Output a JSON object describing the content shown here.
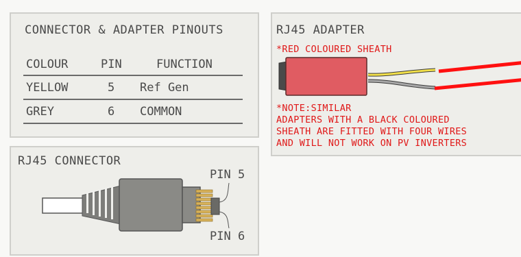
{
  "pinouts": {
    "title": "CONNECTOR & ADAPTER PINOUTS",
    "headers": [
      "COLOUR",
      "PIN",
      "FUNCTION"
    ],
    "rows": [
      [
        "YELLOW",
        "5",
        "Ref Gen"
      ],
      [
        "GREY",
        "6",
        "COMMON"
      ]
    ]
  },
  "adapter": {
    "title": "RJ45 ADAPTER",
    "sheath_note": "*RED COLOURED SHEATH",
    "note_lines": [
      "*NOTE:SIMILAR",
      "ADAPTERS WITH A BLACK COLOURED",
      "SHEATH ARE FITTED WITH FOUR WIRES",
      "AND WILL NOT WORK ON PV INVERTERS"
    ],
    "colors": {
      "sheath": "#e05c62",
      "yellow_wire": "#f2e04a",
      "grey_wire": "#a8a8a8",
      "lead": "#ff1010"
    }
  },
  "connector": {
    "title": "RJ45 CONNECTOR",
    "pin_top": "PIN 5",
    "pin_bottom": "PIN 6",
    "colors": {
      "body": "#8a8a86",
      "contacts": "#d8b25a"
    }
  }
}
